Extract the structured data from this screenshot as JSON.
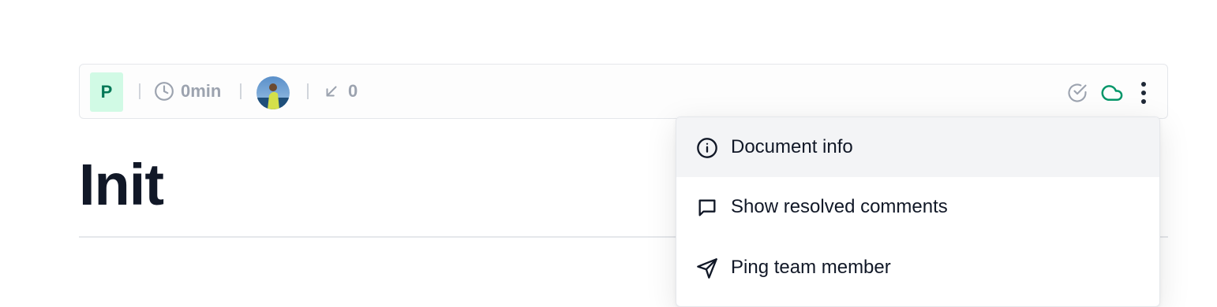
{
  "toolbar": {
    "project_initial": "P",
    "reading_time": "0min",
    "backlinks_count": "0"
  },
  "document": {
    "title": "Init"
  },
  "menu": {
    "items": [
      {
        "label": "Document info",
        "icon": "info-icon",
        "active": true
      },
      {
        "label": "Show resolved comments",
        "icon": "comment-icon",
        "active": false
      },
      {
        "label": "Ping team member",
        "icon": "send-icon",
        "active": false
      }
    ]
  },
  "colors": {
    "accent_green": "#059669",
    "badge_bg": "#d1fae5",
    "muted": "#9ca3af",
    "menu_active_bg": "#f3f4f6"
  }
}
